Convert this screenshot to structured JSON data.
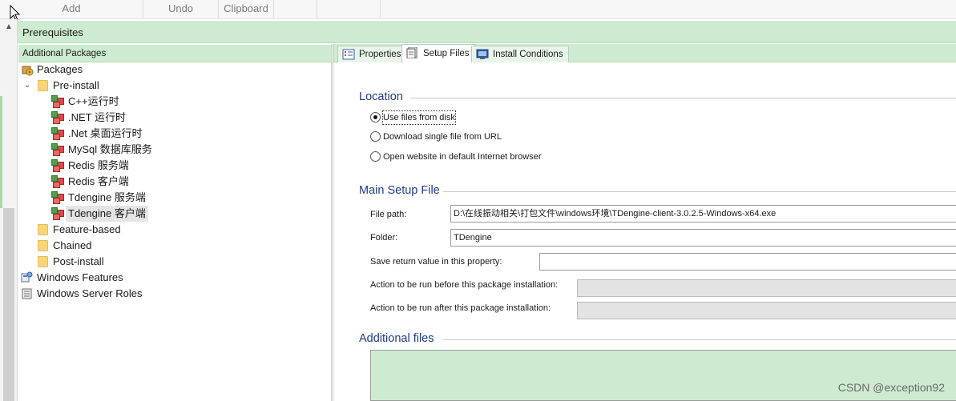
{
  "ribbon": {
    "groups": [
      {
        "label": "Add"
      },
      {
        "label": "Undo"
      },
      {
        "label": "Clipboard"
      },
      {
        "label": ""
      },
      {
        "label": ""
      }
    ]
  },
  "header": {
    "title": "Prerequisites"
  },
  "left_pane": {
    "title": "Additional Packages",
    "tree": {
      "root": "Packages",
      "pre_install": "Pre-install",
      "packages": [
        "C++运行时",
        ".NET 运行时",
        ".Net 桌面运行时",
        "MySql 数据库服务",
        "Redis 服务端",
        "Redis 客户端",
        "Tdengine 服务端",
        "Tdengine 客户端"
      ],
      "selected_package": "Tdengine 客户端",
      "feature_based": "Feature-based",
      "chained": "Chained",
      "post_install": "Post-install",
      "windows_features": "Windows Features",
      "windows_server_roles": "Windows Server Roles"
    }
  },
  "tabs": [
    {
      "label": "Properties",
      "icon": "properties-icon"
    },
    {
      "label": "Setup Files",
      "icon": "setup-files-icon",
      "active": true
    },
    {
      "label": "Install Conditions",
      "icon": "install-conditions-icon"
    }
  ],
  "location": {
    "title": "Location",
    "options": [
      {
        "label": "Use files from disk",
        "selected": true
      },
      {
        "label": "Download single file from URL",
        "selected": false
      },
      {
        "label": "Open website in default Internet browser",
        "selected": false
      }
    ]
  },
  "main_setup_file": {
    "title": "Main Setup File",
    "file_path_label": "File path:",
    "file_path_value": "D:\\在线振动相关\\打包文件\\windows环境\\TDengine-client-3.0.2.5-Windows-x64.exe",
    "folder_label": "Folder:",
    "folder_value": "TDengine",
    "save_return_label": "Save return value in this property:",
    "save_return_value": "",
    "action_before_label": "Action to be run before this package installation:",
    "action_before_value": "",
    "action_after_label": "Action to be run after this package installation:",
    "action_after_value": ""
  },
  "additional_files": {
    "title": "Additional files"
  },
  "watermark": "CSDN @exception92",
  "colors": {
    "panel_green": "#cdebd0",
    "section_title_blue": "#1f3a8a",
    "folder_yellow": "#f7d57a"
  }
}
